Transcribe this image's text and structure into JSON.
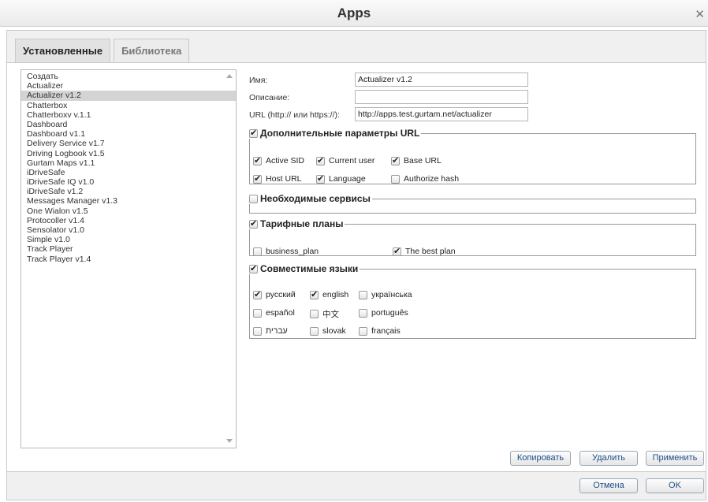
{
  "window": {
    "title": "Apps"
  },
  "tabs": [
    {
      "label": "Установленные",
      "active": true
    },
    {
      "label": "Библиотека",
      "active": false
    }
  ],
  "app_list": {
    "items": [
      "Создать",
      "Actualizer",
      "Actualizer v1.2",
      "Chatterbox",
      "Chatterboxv v.1.1",
      "Dashboard",
      "Dashboard v1.1",
      "Delivery Service v1.7",
      "Driving Logbook v1.5",
      "Gurtam Maps v1.1",
      "iDriveSafe",
      "iDriveSafe IQ v1.0",
      "iDriveSafe v1.2",
      "Messages Manager v1.3",
      "One Wialon v1.5",
      "Protocoller v1.4",
      "Sensolator v1.0",
      "Simple v1.0",
      "Track Player",
      "Track Player v1.4"
    ],
    "selected": "Actualizer v1.2"
  },
  "form": {
    "name_label": "Имя:",
    "name_value": "Actualizer v1.2",
    "description_label": "Описание:",
    "description_value": "",
    "url_label": "URL (http:// или https://):",
    "url_value": "http://apps.test.gurtam.net/actualizer"
  },
  "url_params": {
    "legend": "Дополнительные параметры URL",
    "checked": true,
    "options": [
      {
        "label": "Active SID",
        "checked": true
      },
      {
        "label": "Current user",
        "checked": true
      },
      {
        "label": "Base URL",
        "checked": true
      },
      {
        "label": "Host URL",
        "checked": true
      },
      {
        "label": "Language",
        "checked": true
      },
      {
        "label": "Authorize hash",
        "checked": false
      }
    ]
  },
  "services": {
    "legend": "Необходимые сервисы",
    "checked": false
  },
  "plans": {
    "legend": "Тарифные планы",
    "checked": true,
    "options": [
      {
        "label": "business_plan",
        "checked": false
      },
      {
        "label": "The best plan",
        "checked": true
      }
    ]
  },
  "languages": {
    "legend": "Совместимые языки",
    "checked": true,
    "options": [
      {
        "label": "русский",
        "checked": true
      },
      {
        "label": "english",
        "checked": true
      },
      {
        "label": "українська",
        "checked": false
      },
      {
        "label": "español",
        "checked": false
      },
      {
        "label": "中文",
        "checked": false
      },
      {
        "label": "português",
        "checked": false
      },
      {
        "label": "עברית",
        "checked": false
      },
      {
        "label": "slovak",
        "checked": false
      },
      {
        "label": "français",
        "checked": false
      }
    ]
  },
  "actions": {
    "copy": "Копировать",
    "delete": "Удалить",
    "apply": "Применить"
  },
  "footer": {
    "cancel": "Отмена",
    "ok": "OK"
  }
}
